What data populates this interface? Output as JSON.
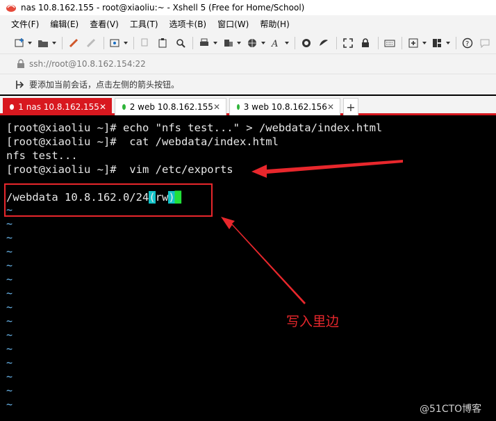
{
  "window": {
    "title": "nas 10.8.162.155 - root@xiaoliu:~ - Xshell 5 (Free for Home/School)"
  },
  "menu": {
    "items": [
      "文件(F)",
      "编辑(E)",
      "查看(V)",
      "工具(T)",
      "选项卡(B)",
      "窗口(W)",
      "帮助(H)"
    ]
  },
  "address": {
    "url": "ssh://root@10.8.162.154:22"
  },
  "hint": {
    "text": "要添加当前会话，点击左侧的箭头按钮。"
  },
  "tabs": [
    {
      "label": "1 nas 10.8.162.155",
      "active": true
    },
    {
      "label": "2 web 10.8.162.155",
      "active": false
    },
    {
      "label": "3 web 10.8.162.156",
      "active": false
    }
  ],
  "terminal": {
    "lines": [
      "[root@xiaoliu ~]# echo \"nfs test...\" > /webdata/index.html",
      "[root@xiaoliu ~]#  cat /webdata/index.html",
      "nfs test...",
      "[root@xiaoliu ~]#  vim /etc/exports"
    ],
    "vim_line": {
      "before": "/webdata 10.8.162.0/24",
      "paren_open": "(",
      "inner": "rw",
      "paren_close": ")"
    },
    "tilde": "~"
  },
  "annotation": {
    "label": "写入里边"
  },
  "watermark": "@51CTO博客",
  "colors": {
    "accent": "#d8181f",
    "annotation": "#e8272c",
    "tab_dot": "#2fb43a"
  }
}
